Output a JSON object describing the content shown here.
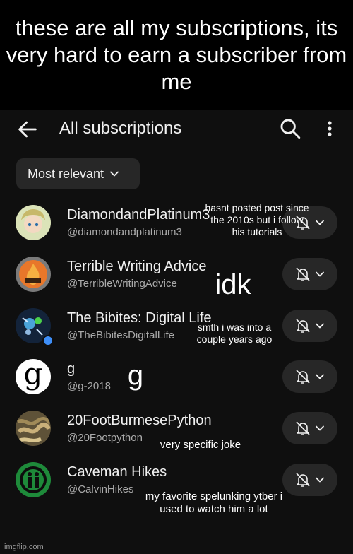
{
  "caption": "these are all my subscriptions, its very hard to earn a subscriber from me",
  "header": {
    "title": "All subscriptions"
  },
  "filter": {
    "label": "Most relevant"
  },
  "channels": [
    {
      "name": "DiamondandPlatinum3",
      "handle": "@diamondandplatinum3"
    },
    {
      "name": "Terrible Writing Advice",
      "handle": "@TerribleWritingAdvice"
    },
    {
      "name": "The Bibites: Digital Life",
      "handle": "@TheBibitesDigitalLife"
    },
    {
      "name": "g",
      "handle": "@g-2018",
      "avatar_letter": "g"
    },
    {
      "name": "20FootBurmesePython",
      "handle": "@20Footpython"
    },
    {
      "name": "Caveman Hikes",
      "handle": "@CalvinHikes"
    }
  ],
  "annotations": {
    "a1": "hasnt posted post since the 2010s but i follow his tutorials",
    "a2": "idk",
    "a3": "smth i was into a couple years ago",
    "a4": "g",
    "a5": "very specific joke",
    "a6": "my favorite spelunking ytber i used to watch him a lot"
  },
  "watermark": "imgflip.com",
  "icons": {
    "back": "arrow-left-icon",
    "search": "search-icon",
    "more": "more-vert-icon",
    "bell": "bell-off-icon",
    "chevron": "chevron-down-icon"
  },
  "colors": {
    "background": "#0f0f0f",
    "chip": "#272727",
    "secondary_text": "#aaaaaa",
    "caption_bg": "#000000"
  }
}
